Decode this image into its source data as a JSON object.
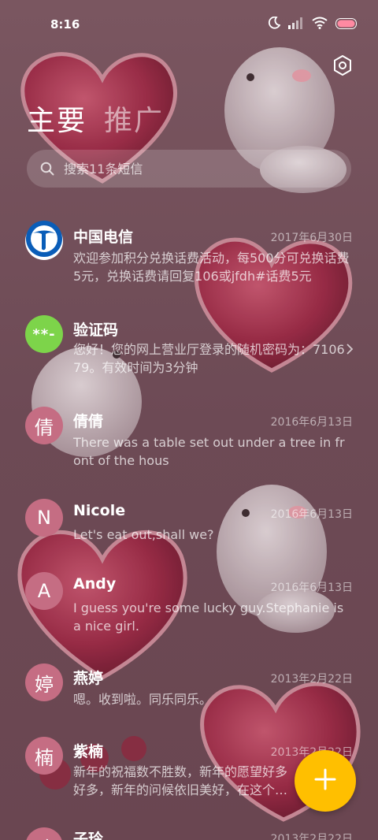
{
  "status_bar": {
    "time": "8:16",
    "icons": [
      "moon-icon",
      "signal-icon",
      "wifi-icon",
      "battery-icon"
    ],
    "battery_color": "#ff8aa2"
  },
  "header": {
    "tabs": [
      {
        "label": "主要",
        "active": true
      },
      {
        "label": "推广",
        "active": false
      }
    ],
    "settings_icon": "settings-icon"
  },
  "search": {
    "placeholder": "搜索11条短信",
    "icon": "search-icon"
  },
  "conversations": [
    {
      "name": "中国电信",
      "avatar": "china-telecom-logo",
      "date": "2017年6月30日",
      "preview": "欢迎参加积分兑换话费活动，每500分可兑换话费5元，兑换话费请回复106或jfdh#话费5元"
    },
    {
      "name": "验证码",
      "avatar": "**-",
      "date": "",
      "preview": "您好！您的网上营业厅登录的随机密码为：710679。有效时间为3分钟",
      "has_chevron": true
    },
    {
      "name": "倩倩",
      "avatar": "倩",
      "date": "2016年6月13日",
      "preview": "There was a table set out under a tree in front of the hous"
    },
    {
      "name": "Nicole",
      "avatar": "N",
      "date": "2016年6月13日",
      "preview": "Let's eat out,shall we?"
    },
    {
      "name": "Andy",
      "avatar": "A",
      "date": "2016年6月13日",
      "preview": "I guess you're some lucky guy.Stephanie is a nice girl."
    },
    {
      "name": "燕婷",
      "avatar": "婷",
      "date": "2013年2月22日",
      "preview": "嗯。收到啦。同乐同乐。"
    },
    {
      "name": "紫楠",
      "avatar": "楠",
      "date": "2013年2月22日",
      "preview": "新年的祝福数不胜数，新年的愿望好多好多，新年的问候依旧美好，在这个温馨的时刻"
    },
    {
      "name": "子玲",
      "avatar": "玲",
      "date": "2013年2月22日",
      "preview": ""
    }
  ],
  "fab": {
    "icon": "plus-icon",
    "color": "#ffbf00"
  },
  "colors": {
    "avatar_default": "#c56d83",
    "avatar_code": "#7dd44a",
    "telecom_blue": "#0a5db8"
  }
}
